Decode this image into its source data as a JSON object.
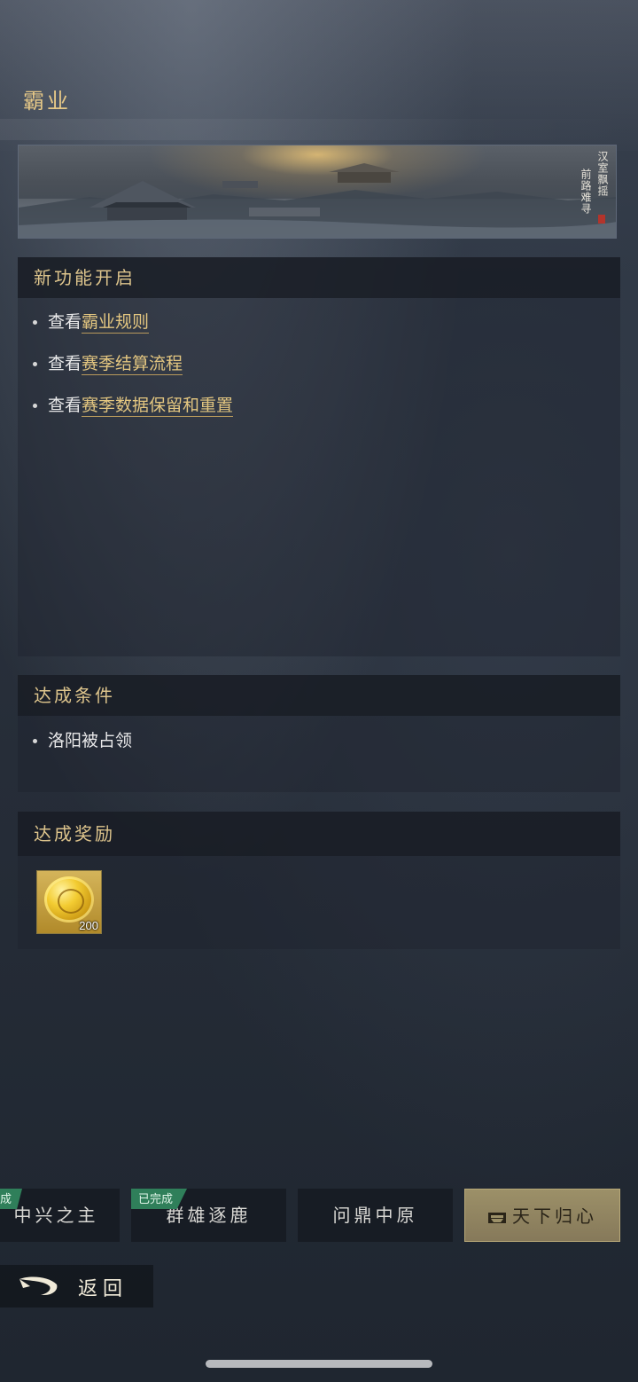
{
  "page": {
    "title": "霸业"
  },
  "banner": {
    "poem_col1": "汉室飘摇",
    "poem_col2": "前路难寻"
  },
  "features": {
    "header": "新功能开启",
    "items": [
      {
        "prefix": "查看",
        "link": "霸业规则"
      },
      {
        "prefix": "查看",
        "link": "赛季结算流程"
      },
      {
        "prefix": "查看",
        "link": "赛季数据保留和重置"
      }
    ]
  },
  "conditions": {
    "header": "达成条件",
    "items": [
      "洛阳被占领"
    ]
  },
  "rewards": {
    "header": "达成奖励",
    "items": [
      {
        "icon": "gold-coin-icon",
        "count": "200"
      }
    ]
  },
  "tabs": [
    {
      "label": "中兴之主",
      "status": "成"
    },
    {
      "label": "群雄逐鹿",
      "status": "已完成"
    },
    {
      "label": "问鼎中原",
      "status": ""
    },
    {
      "label": "天下归心",
      "status": "",
      "active": true
    }
  ],
  "back": {
    "label": "返回"
  },
  "colors": {
    "gold_text": "#e3c680",
    "done_tag": "#2f7f5a",
    "active_tab": "#9c9068"
  }
}
